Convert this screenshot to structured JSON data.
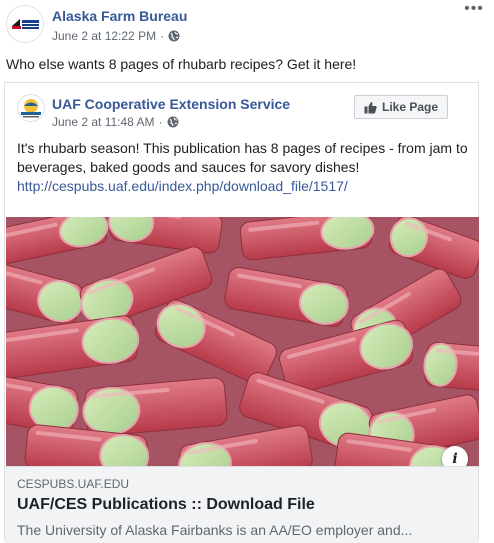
{
  "outer_post": {
    "page_name": "Alaska Farm Bureau",
    "avatar_text": "ALASKA FARM BUREAU",
    "timestamp": "June 2 at 12:22 PM",
    "separator": "·",
    "text": "Who else wants 8 pages of rhubarb recipes? Get it here!",
    "more_icon": "more-options-icon"
  },
  "shared_post": {
    "page_name": "UAF Cooperative Extension Service",
    "avatar_text": "EXTENSION",
    "timestamp": "June 2 at 11:48 AM",
    "separator": "·",
    "like_page_label": "Like Page",
    "text": "It's rhubarb season! This publication has 8 pages of recipes - from jam to beverages, baked goods and sauces for savory dishes!",
    "link": "http://cespubs.uaf.edu/index.php/download_file/1517/"
  },
  "link_preview": {
    "domain": "CESPUBS.UAF.EDU",
    "title": "UAF/CES Publications :: Download File",
    "description": "The University of Alaska Fairbanks is an AA/EO employer and..."
  },
  "colors": {
    "link_blue": "#385898",
    "rhubarb_red": "#c24b5a",
    "rhubarb_green": "#b5d99a"
  }
}
